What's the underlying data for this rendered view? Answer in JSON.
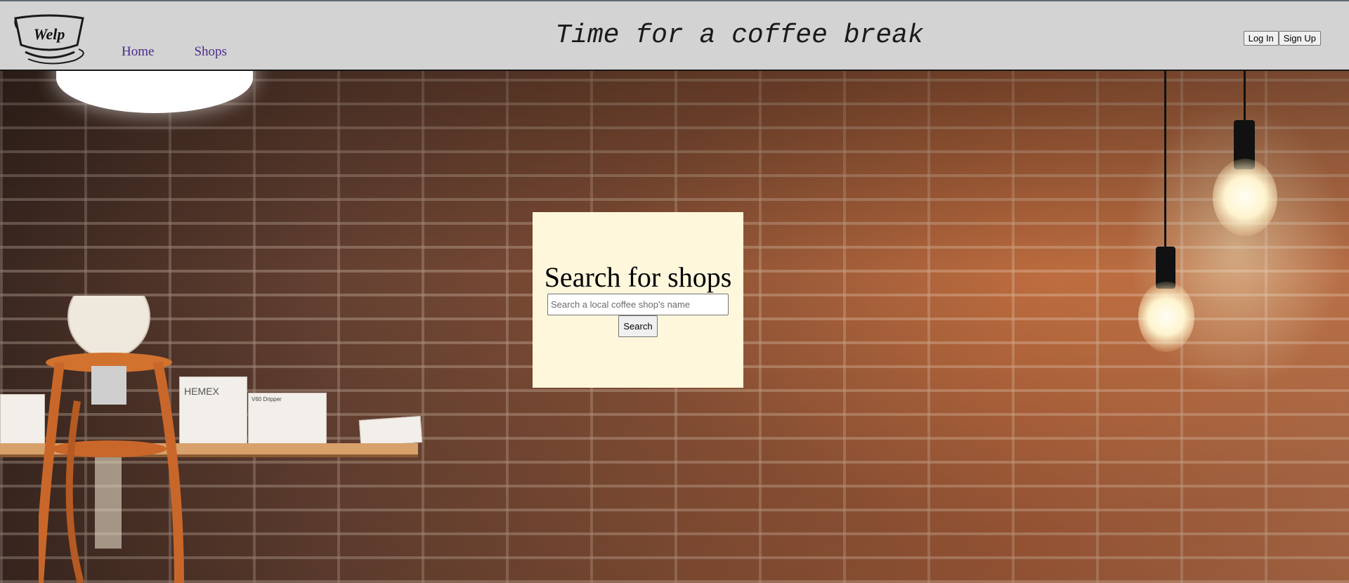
{
  "header": {
    "logo_text": "Welp",
    "tagline": "Time for a coffee break",
    "nav": [
      {
        "label": "Home"
      },
      {
        "label": "Shops"
      }
    ],
    "auth": {
      "login_label": "Log In",
      "signup_label": "Sign Up"
    }
  },
  "hero": {
    "shelf_box_labels": [
      "HEMEX",
      "V60 Dripper"
    ]
  },
  "search": {
    "title": "Search for shops",
    "placeholder": "Search a local coffee shop's name",
    "value": "",
    "button_label": "Search"
  },
  "colors": {
    "header_bg": "#d3d3d3",
    "nav_link": "#4b2c8a",
    "panel_bg": "#fff7dc"
  }
}
